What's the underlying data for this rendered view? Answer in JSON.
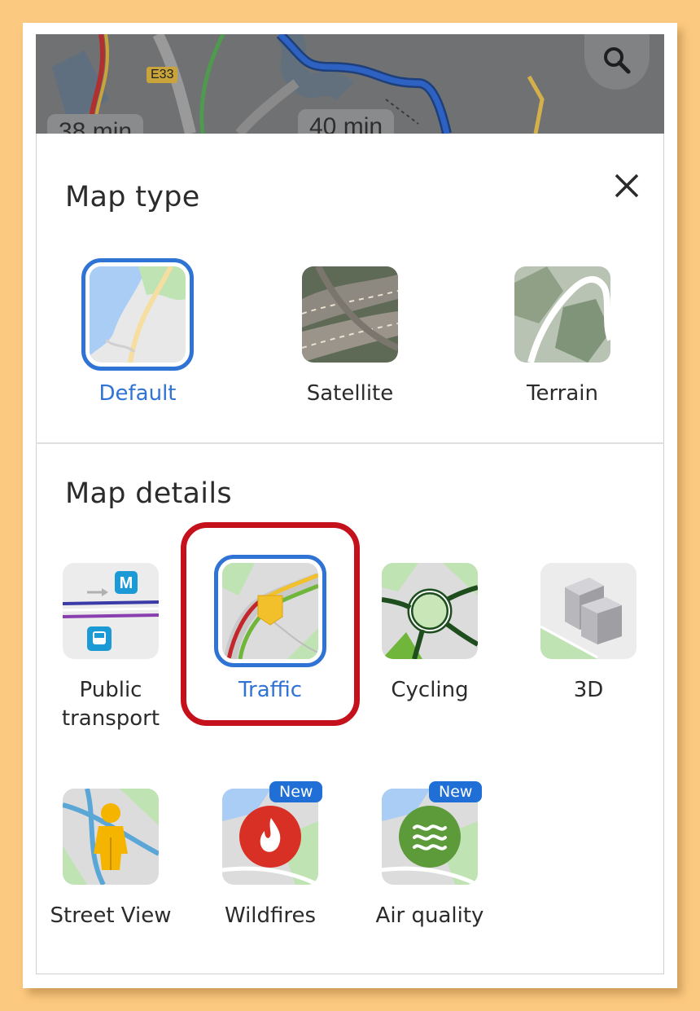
{
  "map": {
    "road_label": "E33",
    "eta_left": "38 min",
    "eta_right": "40 min"
  },
  "header": {
    "search_icon": "search-icon",
    "close_icon": "close-icon"
  },
  "map_type": {
    "title": "Map type",
    "options": [
      {
        "label": "Default",
        "selected": true
      },
      {
        "label": "Satellite",
        "selected": false
      },
      {
        "label": "Terrain",
        "selected": false
      }
    ]
  },
  "map_details": {
    "title": "Map details",
    "options": [
      {
        "label": "Public transport",
        "line1": "Public",
        "line2": "transport",
        "selected": false
      },
      {
        "label": "Traffic",
        "selected": true
      },
      {
        "label": "Cycling",
        "selected": false
      },
      {
        "label": "3D",
        "selected": false
      },
      {
        "label": "Street View",
        "selected": false
      },
      {
        "label": "Wildfires",
        "selected": false,
        "badge": "New"
      },
      {
        "label": "Air quality",
        "selected": false,
        "badge": "New"
      }
    ]
  },
  "colors": {
    "accent": "#2f73d4",
    "highlight": "#c4111c",
    "background": "#fcc981"
  }
}
